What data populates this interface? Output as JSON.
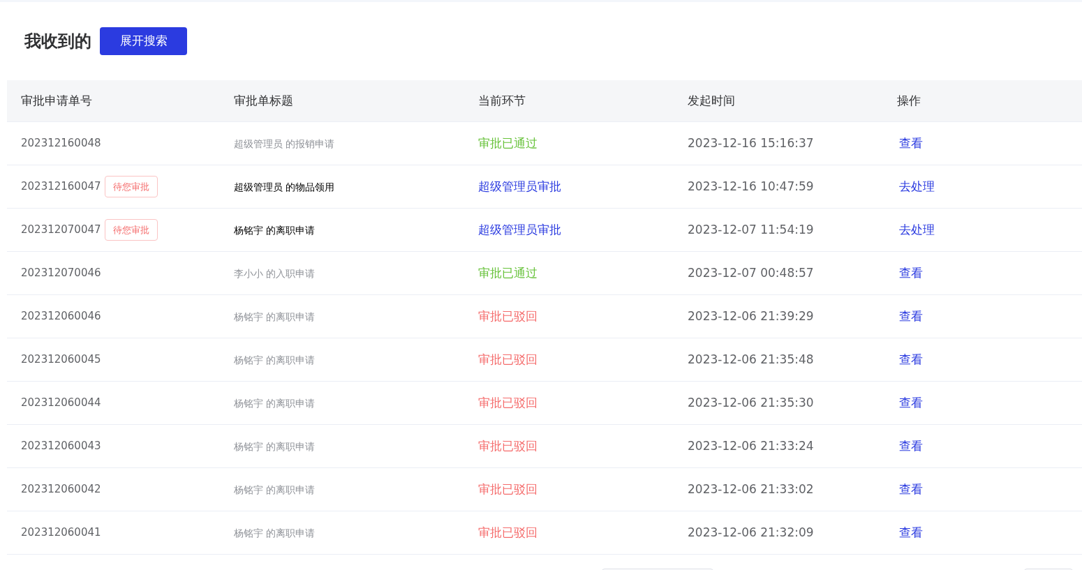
{
  "page": {
    "title": "我收到的",
    "search_button": "展开搜索"
  },
  "table": {
    "columns": [
      "审批申请单号",
      "审批单标题",
      "当前环节",
      "发起时间",
      "操作"
    ],
    "rows": [
      {
        "number": "202312160048",
        "pending": false,
        "title": "超级管理员 的报销申请",
        "stage": "审批已通过",
        "kind": "approved",
        "time": "2023-12-16 15:16:37",
        "action": "查看"
      },
      {
        "number": "202312160047",
        "pending": true,
        "badge": "待您审批",
        "title": "超级管理员 的物品领用",
        "stage": "超级管理员审批",
        "kind": "current",
        "time": "2023-12-16 10:47:59",
        "action": "去处理"
      },
      {
        "number": "202312070047",
        "pending": true,
        "badge": "待您审批",
        "title": "杨铭宇 的离职申请",
        "stage": "超级管理员审批",
        "kind": "current",
        "time": "2023-12-07 11:54:19",
        "action": "去处理"
      },
      {
        "number": "202312070046",
        "pending": false,
        "title": "李小小 的入职申请",
        "stage": "审批已通过",
        "kind": "approved",
        "time": "2023-12-07 00:48:57",
        "action": "查看"
      },
      {
        "number": "202312060046",
        "pending": false,
        "title": "杨铭宇 的离职申请",
        "stage": "审批已驳回",
        "kind": "rejected",
        "time": "2023-12-06 21:39:29",
        "action": "查看"
      },
      {
        "number": "202312060045",
        "pending": false,
        "title": "杨铭宇 的离职申请",
        "stage": "审批已驳回",
        "kind": "rejected",
        "time": "2023-12-06 21:35:48",
        "action": "查看"
      },
      {
        "number": "202312060044",
        "pending": false,
        "title": "杨铭宇 的离职申请",
        "stage": "审批已驳回",
        "kind": "rejected",
        "time": "2023-12-06 21:35:30",
        "action": "查看"
      },
      {
        "number": "202312060043",
        "pending": false,
        "title": "杨铭宇 的离职申请",
        "stage": "审批已驳回",
        "kind": "rejected",
        "time": "2023-12-06 21:33:24",
        "action": "查看"
      },
      {
        "number": "202312060042",
        "pending": false,
        "title": "杨铭宇 的离职申请",
        "stage": "审批已驳回",
        "kind": "rejected",
        "time": "2023-12-06 21:33:02",
        "action": "查看"
      },
      {
        "number": "202312060041",
        "pending": false,
        "title": "杨铭宇 的离职申请",
        "stage": "审批已驳回",
        "kind": "rejected",
        "time": "2023-12-06 21:32:09",
        "action": "查看"
      }
    ]
  }
}
